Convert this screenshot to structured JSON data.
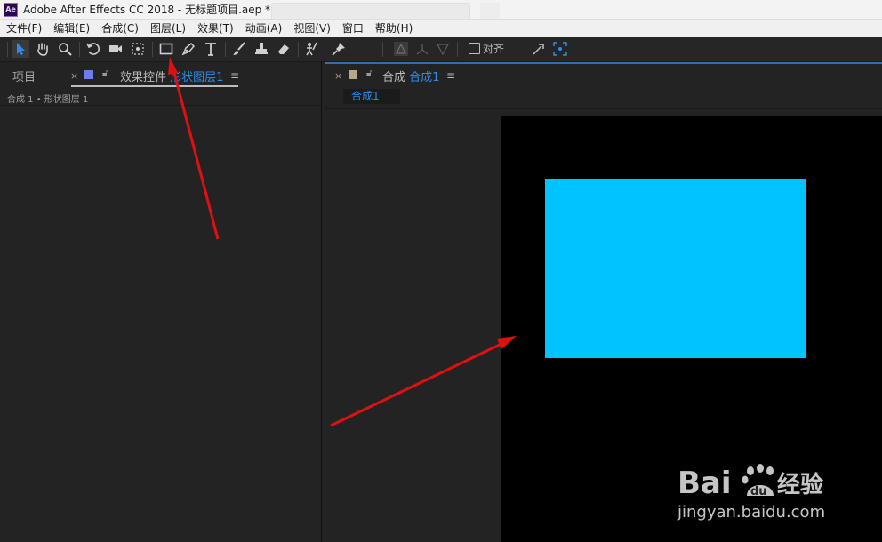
{
  "window": {
    "title": "Adobe After Effects CC 2018 - 无标题项目.aep *",
    "app_badge": "Ae"
  },
  "menu": [
    "文件(F)",
    "编辑(E)",
    "合成(C)",
    "图层(L)",
    "效果(T)",
    "动画(A)",
    "视图(V)",
    "窗口",
    "帮助(H)"
  ],
  "toolbar": {
    "tools": [
      "selection-tool",
      "hand-tool",
      "zoom-tool",
      "rotation-tool",
      "camera-tool",
      "pan-behind-tool",
      "rectangle-tool",
      "pen-tool",
      "type-tool",
      "brush-tool",
      "clone-stamp-tool",
      "eraser-tool",
      "roto-brush-tool",
      "puppet-pin-tool"
    ],
    "align_label": "对齐"
  },
  "left_panel": {
    "project_tab": "项目",
    "effect_tab_prefix": "效果控件",
    "effect_tab_layer": "形状图层1",
    "breadcrumb": "合成 1 • 形状图层 1"
  },
  "right_panel": {
    "comp_tab_prefix": "合成",
    "comp_tab_name": "合成1",
    "sub_tab": "合成1"
  },
  "colors": {
    "accent": "#2d8ceb",
    "shape_fill": "#00c3ff",
    "tab_swatch_left": "#6a7ef0",
    "tab_swatch_right": "#b8a88a",
    "annotation_arrow": "#e01010"
  },
  "watermark": {
    "logo": "Bai du 经验",
    "url": "jingyan.baidu.com"
  }
}
